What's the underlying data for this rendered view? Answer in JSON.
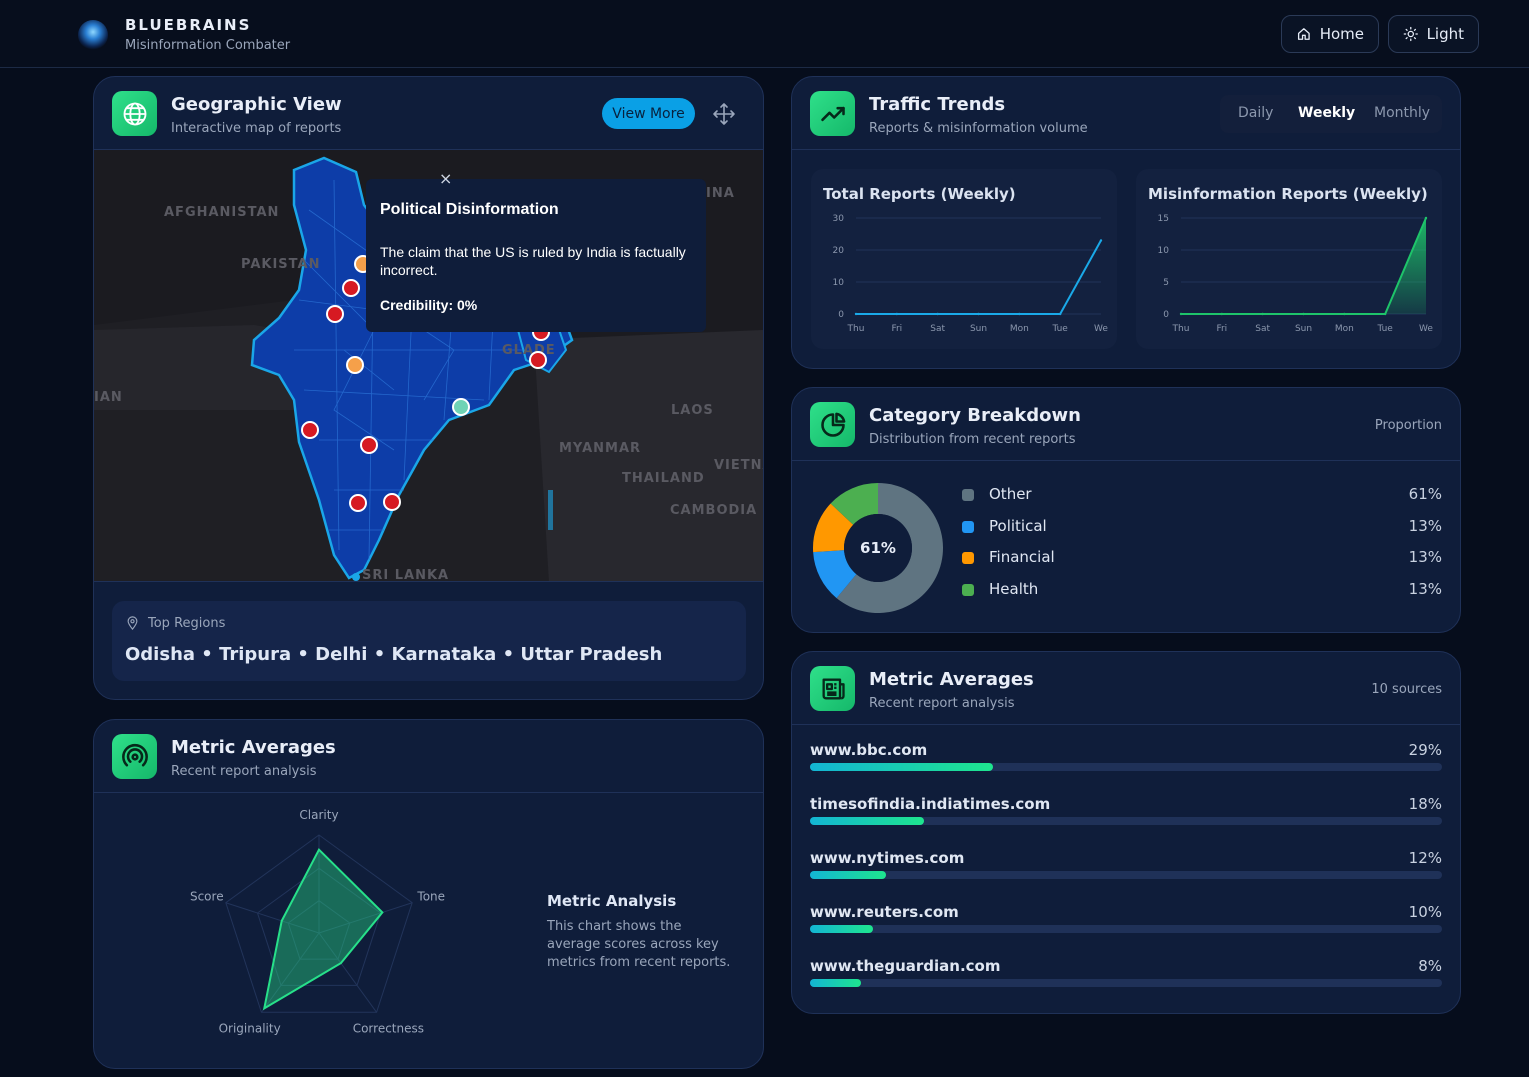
{
  "header": {
    "brand_name": "BLUEBRAINS",
    "brand_sub": "Misinformation Combater",
    "home_label": "Home",
    "theme_label": "Light"
  },
  "geo": {
    "title": "Geographic View",
    "subtitle": "Interactive map of reports",
    "view_more_label": "View More",
    "map_labels": [
      "AFGHANISTAN",
      "PAKISTAN",
      "INA",
      "IAN",
      "LAOS",
      "MYANMAR",
      "VIETNA",
      "THAILAND",
      "CAMBODIA",
      "SRI LANKA",
      "GLADE"
    ],
    "popup": {
      "title": "Political Disinformation",
      "text": "The claim that the US is ruled by India is factually incorrect.",
      "credibility": "Credibility: 0%",
      "close": "×"
    },
    "top_regions_label": "Top Regions",
    "top_regions": "Odisha • Tripura • Delhi • Karnataka • Uttar Pradesh"
  },
  "traffic": {
    "title": "Traffic Trends",
    "subtitle": "Reports & misinformation volume",
    "tabs": [
      "Daily",
      "Weekly",
      "Monthly"
    ],
    "active_tab": "Weekly"
  },
  "chart_data": [
    {
      "type": "line",
      "title": "Total Reports (Weekly)",
      "x": [
        "Thu",
        "Fri",
        "Sat",
        "Sun",
        "Mon",
        "Tue",
        "We"
      ],
      "values": [
        0,
        0,
        0,
        0,
        0,
        0,
        23
      ],
      "yticks": [
        0,
        10,
        20,
        30
      ],
      "ylim": [
        0,
        30
      ],
      "color": "#1aa9e8",
      "grid": true
    },
    {
      "type": "area",
      "title": "Misinformation Reports (Weekly)",
      "x": [
        "Thu",
        "Fri",
        "Sat",
        "Sun",
        "Mon",
        "Tue",
        "We"
      ],
      "values": [
        0,
        0,
        0,
        0,
        0,
        0,
        15
      ],
      "yticks": [
        0,
        5,
        10,
        15
      ],
      "ylim": [
        0,
        15
      ],
      "color": "#1ec46a",
      "grid": true
    },
    {
      "type": "pie",
      "title": "Category Breakdown",
      "center_label": "61%",
      "categories": [
        "Other",
        "Political",
        "Financial",
        "Health"
      ],
      "values": [
        61,
        13,
        13,
        13
      ],
      "labels": [
        "61%",
        "13%",
        "13%",
        "13%"
      ],
      "colors": [
        "#5f7481",
        "#2196f3",
        "#ff9800",
        "#4caf50"
      ]
    },
    {
      "type": "radar",
      "title": "Metric Averages",
      "axes": [
        "Clarity",
        "Tone",
        "Correctness",
        "Originality",
        "Score"
      ],
      "values": [
        0.85,
        0.68,
        0.38,
        0.95,
        0.4
      ],
      "color": "#27e08a"
    }
  ],
  "category": {
    "title": "Category Breakdown",
    "subtitle": "Distribution from recent reports",
    "proportion_label": "Proportion"
  },
  "sources": {
    "title": "Metric Averages",
    "subtitle": "Recent report analysis",
    "count_label": "10 sources",
    "items": [
      {
        "name": "www.bbc.com",
        "label": "29%",
        "value": 0.29
      },
      {
        "name": "timesofindia.indiatimes.com",
        "label": "18%",
        "value": 0.18
      },
      {
        "name": "www.nytimes.com",
        "label": "12%",
        "value": 0.12
      },
      {
        "name": "www.reuters.com",
        "label": "10%",
        "value": 0.1
      },
      {
        "name": "www.theguardian.com",
        "label": "8%",
        "value": 0.08
      }
    ]
  },
  "radar": {
    "title": "Metric Averages",
    "subtitle": "Recent report analysis",
    "analysis_title": "Metric Analysis",
    "analysis_text": "This chart shows the average scores across key metrics from recent reports."
  }
}
